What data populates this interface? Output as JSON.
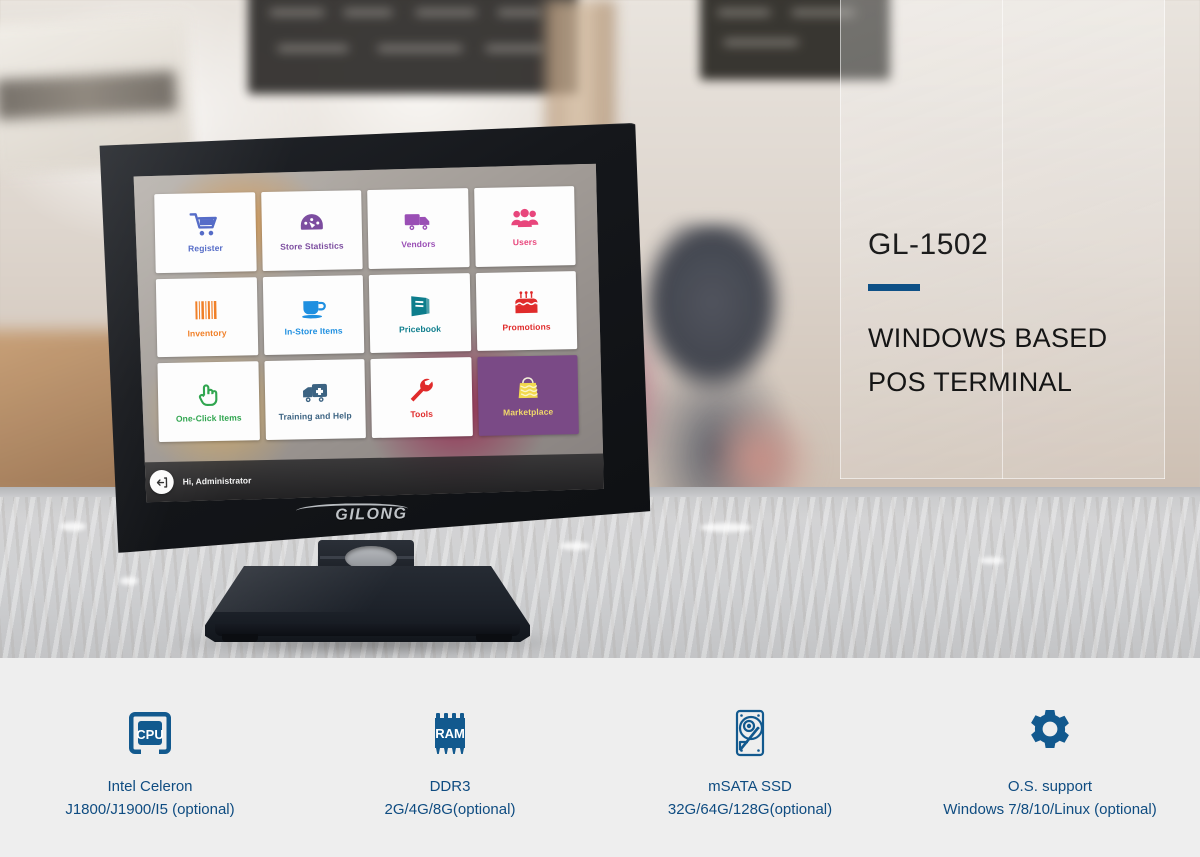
{
  "product": {
    "model": "GL-1502",
    "headline_line1": "WINDOWS BASED",
    "headline_line2": "POS TERMINAL",
    "accent_color": "#0d5086",
    "brand_logo": "GILONG"
  },
  "pos_screen": {
    "tiles": [
      {
        "label": "Register",
        "icon": "shopping-cart-icon",
        "color": "#4b63c4"
      },
      {
        "label": "Store Statistics",
        "icon": "gauge-icon",
        "color": "#7a4a9e"
      },
      {
        "label": "Vendors",
        "icon": "delivery-truck-icon",
        "color": "#9a4fb5"
      },
      {
        "label": "Users",
        "icon": "users-group-icon",
        "color": "#e8467c"
      },
      {
        "label": "Inventory",
        "icon": "barcode-icon",
        "color": "#f07a1e"
      },
      {
        "label": "In-Store Items",
        "icon": "coffee-cup-icon",
        "color": "#1e8fe0"
      },
      {
        "label": "Pricebook",
        "icon": "book-icon",
        "color": "#0d7d8c"
      },
      {
        "label": "Promotions",
        "icon": "birthday-cake-icon",
        "color": "#e02b2b"
      },
      {
        "label": "One-Click Items",
        "icon": "pointing-hand-icon",
        "color": "#2aa34a"
      },
      {
        "label": "Training and Help",
        "icon": "ambulance-icon",
        "color": "#3c6382"
      },
      {
        "label": "Tools",
        "icon": "wrench-icon",
        "color": "#e02b2b"
      },
      {
        "label": "Marketplace",
        "icon": "shopping-bag-icon",
        "color": "#f1d96a",
        "tile_bg": "#7a4a86"
      }
    ],
    "taskbar": {
      "user_greeting": "Hi, Administrator",
      "user_icon": "logout-arrow-icon"
    }
  },
  "specs": [
    {
      "icon": "cpu-chip-icon",
      "title": "Intel Celeron",
      "sub": "J1800/J1900/I5 (optional)"
    },
    {
      "icon": "ram-chip-icon",
      "title": "DDR3",
      "sub": "2G/4G/8G(optional)"
    },
    {
      "icon": "hard-drive-icon",
      "title": "mSATA SSD",
      "sub": "32G/64G/128G(optional)"
    },
    {
      "icon": "gear-icon",
      "title": "O.S. support",
      "sub": "Windows 7/8/10/Linux (optional)"
    }
  ]
}
